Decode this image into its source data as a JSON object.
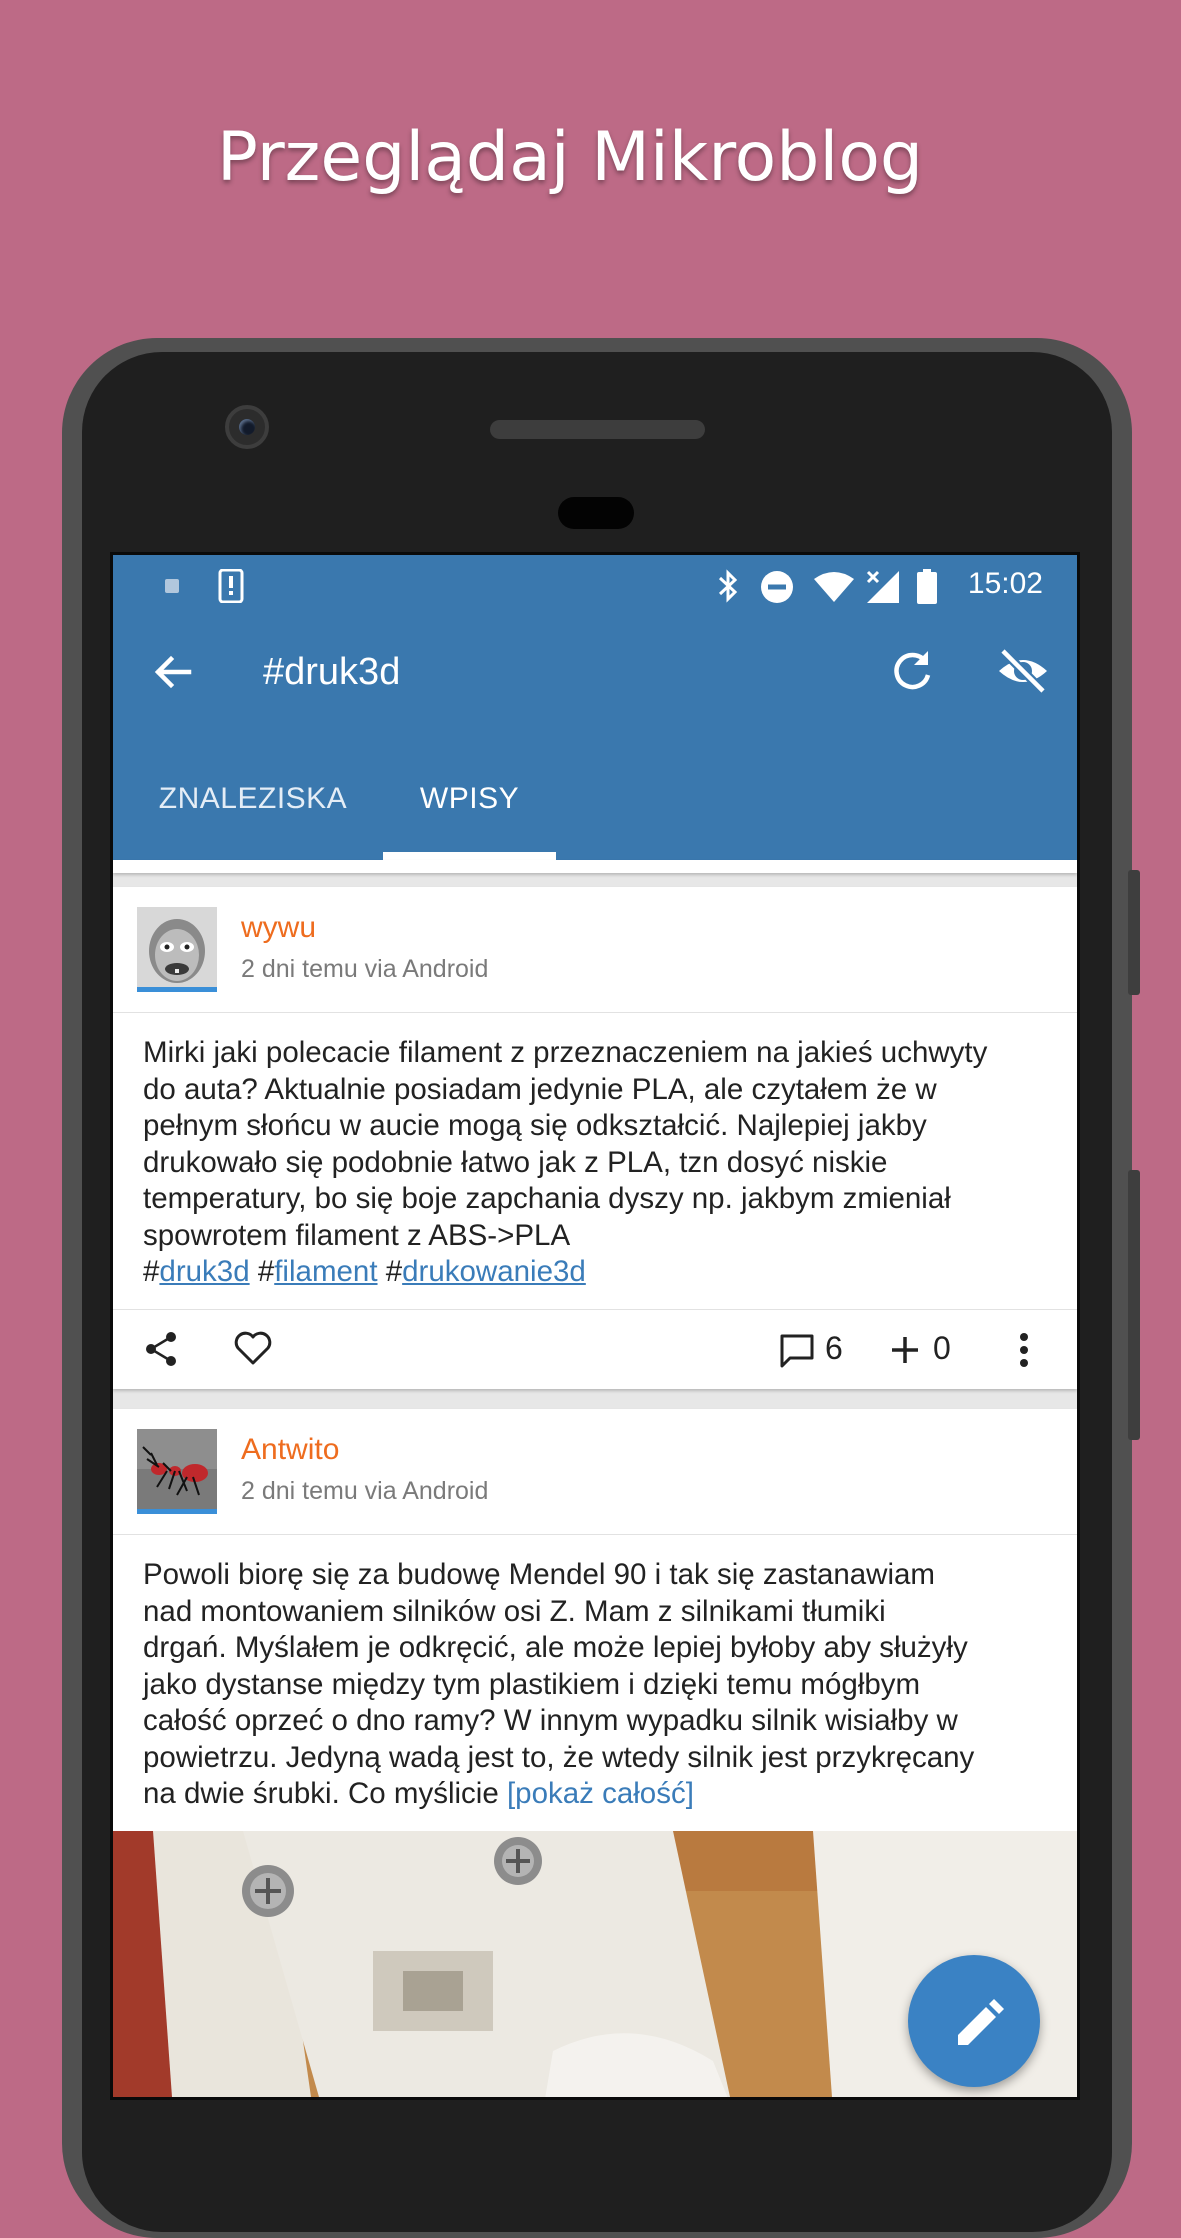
{
  "headline": "Przeglądaj Mikroblog",
  "status_bar": {
    "time": "15:02",
    "icons": [
      "notification-icon",
      "alert-icon",
      "bluetooth-icon",
      "do-not-disturb-icon",
      "wifi-icon",
      "signal-icon",
      "battery-icon"
    ]
  },
  "toolbar": {
    "title": "#druk3d",
    "icons": [
      "back-arrow-icon",
      "refresh-icon",
      "eye-off-icon"
    ]
  },
  "tabs": [
    {
      "label": "ZNALEZISKA",
      "active": false
    },
    {
      "label": "WPISY",
      "active": true
    }
  ],
  "posts": [
    {
      "author": "wywu",
      "meta": "2 dni temu via Android",
      "lines": [
        "Mirki jaki polecacie filament z przeznaczeniem na jakieś uchwyty",
        "do auta? Aktualnie posiadam jedynie PLA, ale czytałem że w",
        "pełnym słońcu w aucie mogą się odkształcić. Najlepiej jakby",
        "drukowało się podobnie łatwo jak z PLA, tzn dosyć niskie",
        "temperatury, bo się boje zapchania dyszy np. jakbym zmieniał",
        "spowrotem filament z ABS->PLA"
      ],
      "tags": [
        "druk3d",
        "filament",
        "drukowanie3d"
      ],
      "comments": "6",
      "votes": "0"
    },
    {
      "author": "Antwito",
      "meta": "2 dni temu via Android",
      "lines": [
        "Powoli biorę się za budowę Mendel 90 i tak się zastanawiam",
        "nad montowaniem silników osi Z. Mam z silnikami tłumiki",
        "drgań. Myślałem je odkręcić, ale może lepiej byłoby aby służyły",
        "jako dystanse między tym plastikiem i dzięki temu mógłbym",
        "całość oprzeć o dno ramy? W innym wypadku silnik wisiałby w",
        "powietrzu. Jedyną wadą jest to, że wtedy silnik jest przykręcany",
        "na dwie śrubki. Co myślicie"
      ],
      "more": "[pokaż całość]"
    }
  ],
  "fab_icon": "pencil-icon",
  "colors": {
    "background": "#bd6a86",
    "appbar": "#3a78ae",
    "author": "#ee6c1e",
    "link": "#3a7cb9",
    "fab": "#3a82c4"
  }
}
